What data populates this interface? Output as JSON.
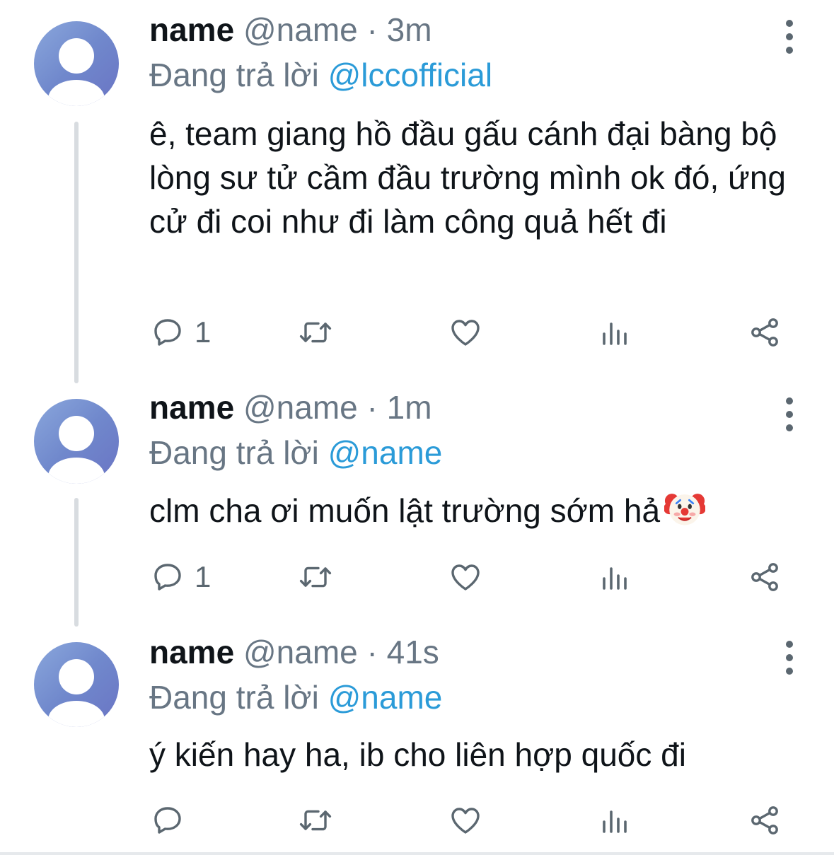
{
  "tweets": [
    {
      "name": "name",
      "handle": "@name",
      "separator": "·",
      "time": "3m",
      "reply_prefix": "Đang trả lời",
      "reply_to": "@lccofficial",
      "text": "ê, team giang hồ đầu gấu cánh đại bàng bộ lòng sư tử cầm đầu trường mình ok đó, ứng cử đi coi như đi làm công quả hết đi",
      "reply_count": "1"
    },
    {
      "name": "name",
      "handle": "@name",
      "separator": "·",
      "time": "1m",
      "reply_prefix": "Đang trả lời",
      "reply_to": "@name",
      "text": "clm cha ơi muốn lật trường sớm hả",
      "emoji": "clown-face",
      "reply_count": "1"
    },
    {
      "name": "name",
      "handle": "@name",
      "separator": "·",
      "time": "41s",
      "reply_prefix": "Đang trả lời",
      "reply_to": "@name",
      "text": "ý kiến hay ha, ib cho liên hợp quốc đi",
      "reply_count": ""
    }
  ],
  "icons": {
    "more": "more-vertical-icon",
    "reply": "comment-icon",
    "retweet": "retweet-icon",
    "like": "heart-icon",
    "views": "analytics-icon",
    "share": "share-icon"
  },
  "colors": {
    "text": "#0f1419",
    "secondary": "#687684",
    "mention": "#2b9bd8",
    "icon": "#5b6770",
    "thread_line": "#d8dce0"
  }
}
